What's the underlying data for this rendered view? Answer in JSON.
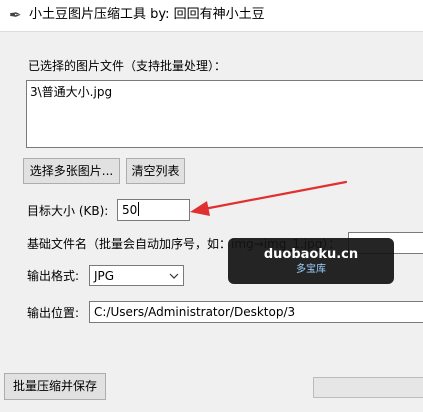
{
  "window": {
    "title": "小土豆图片压缩工具 by: 回回有神小土豆",
    "icon": "feather-icon"
  },
  "file_list": {
    "label": "已选择的图片文件（支持批量处理）：",
    "items": [
      "3\\普通大小.jpg"
    ]
  },
  "buttons": {
    "select_label": "选择多张图片...",
    "clear_label": "清空列表",
    "compress_label": "批量压缩并保存"
  },
  "target_size": {
    "label": "目标大小 (KB):",
    "value": "50"
  },
  "base_name": {
    "label": "基础文件名（批量会自动加序号，如：img→img_1.jpg）：",
    "value": ""
  },
  "format": {
    "label": "输出格式:",
    "selected": "JPG"
  },
  "output": {
    "label": "输出位置:",
    "path": "C:/Users/Administrator/Desktop/3"
  },
  "progress": {
    "value": 0
  },
  "watermark": {
    "text": "duobaoku.cn",
    "sub": "多宝库"
  },
  "colors": {
    "annotation_arrow": "#e03030",
    "progress_fill": "#06b025"
  }
}
